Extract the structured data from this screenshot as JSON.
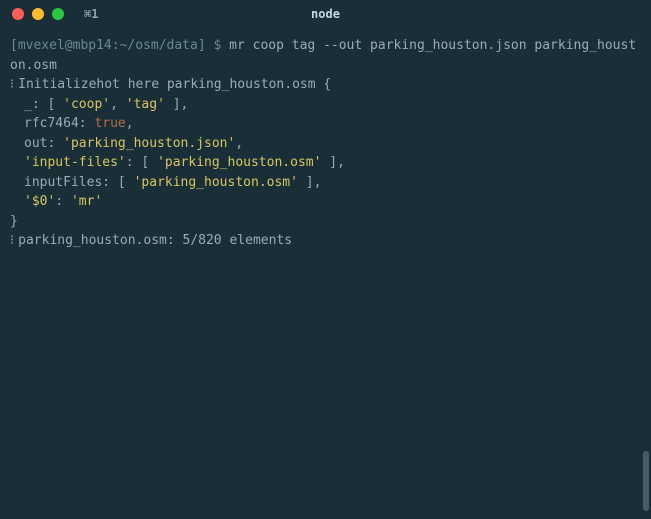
{
  "titlebar": {
    "tab_label": "⌘1",
    "window_title": "node"
  },
  "prompt": "[mvexel@mbp14:~/osm/data] $ ",
  "command": "mr coop tag --out parking_houston.json parking_houston.osm",
  "output": {
    "init_line": "Initializehot here parking_houston.osm {",
    "entries": [
      {
        "key": "_",
        "prefix": ": [ ",
        "values": [
          "'coop'",
          "'tag'"
        ],
        "suffix": " ],"
      },
      {
        "key": "rfc7464",
        "prefix": ": ",
        "bool": "true",
        "suffix": ","
      },
      {
        "key": "out",
        "prefix": ": ",
        "string": "'parking_houston.json'",
        "suffix": ","
      },
      {
        "key": "'input-files'",
        "prefix": ": [ ",
        "values": [
          "'parking_houston.osm'"
        ],
        "suffix": " ],"
      },
      {
        "key": "inputFiles",
        "prefix": ": [ ",
        "values": [
          "'parking_houston.osm'"
        ],
        "suffix": " ],"
      },
      {
        "key": "'$0'",
        "prefix": ": ",
        "string": "'mr'",
        "suffix": ""
      }
    ],
    "close_brace": "}",
    "status": "parking_houston.osm: 5/820 elements"
  },
  "marker": "⁝"
}
